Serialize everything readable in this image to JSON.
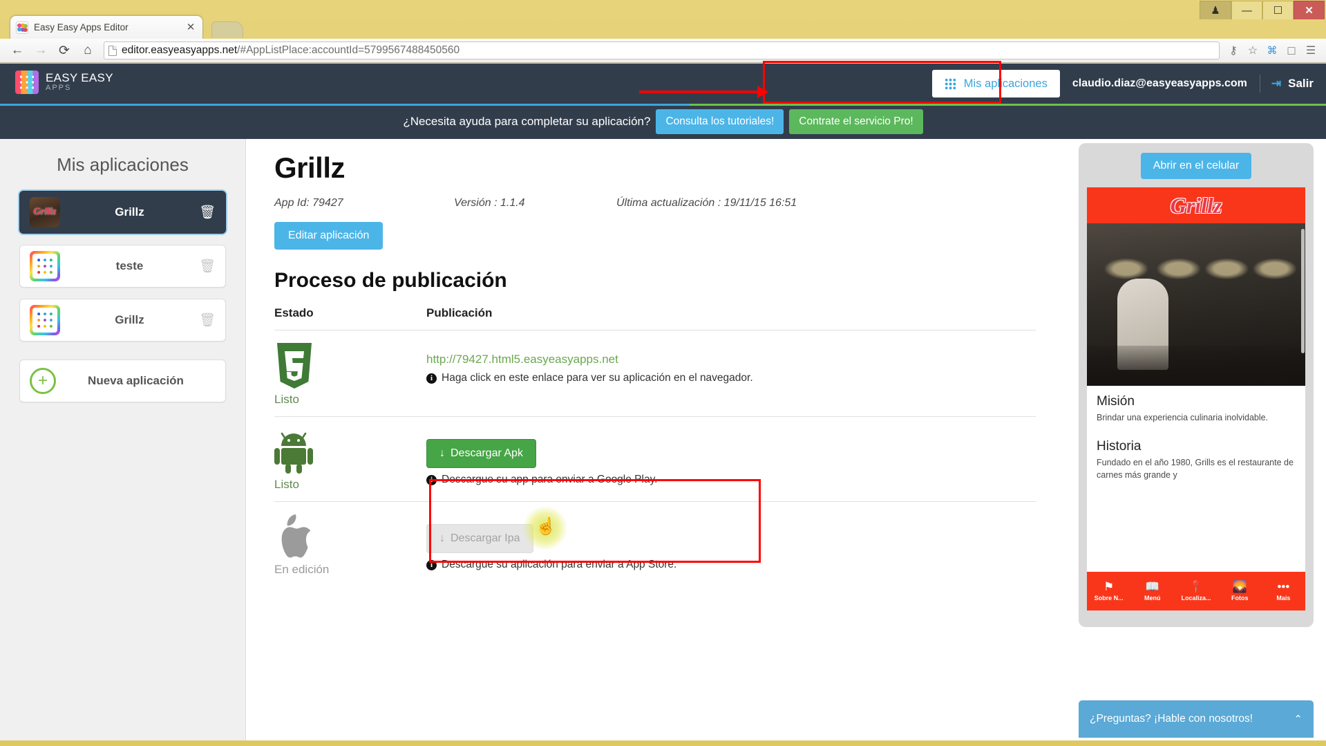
{
  "window": {
    "controls": [
      {
        "name": "user-profile",
        "glyph": "♟"
      },
      {
        "name": "minimize",
        "glyph": "—"
      },
      {
        "name": "maximize",
        "glyph": "☐"
      },
      {
        "name": "close",
        "glyph": "✕"
      }
    ]
  },
  "browser": {
    "tab_title": "Easy Easy Apps Editor",
    "tab_close": "✕",
    "url_host": "editor.easyeasyapps.net",
    "url_path": "/#AppListPlace:accountId=5799567488450560",
    "back": "←",
    "forward": "→",
    "reload": "⟳",
    "home": "⌂",
    "key_icon": "⚷",
    "star_icon": "☆",
    "extension_icon": "⌘",
    "capture_icon": "□",
    "menu_icon": "☰"
  },
  "header": {
    "brand_main": "EASY EASY",
    "brand_sub": "APPS",
    "my_apps_label": "Mis aplicaciones",
    "user_email": "claudio.diaz@easyeasyapps.com",
    "logout_label": "Salir",
    "logout_icon": "⇥"
  },
  "promo": {
    "text": "¿Necesita ayuda para completar su aplicación?",
    "tutorials_label": "Consulta los tutoriales!",
    "pro_label": "Contrate el servicio Pro!"
  },
  "sidebar": {
    "title": "Mis aplicaciones",
    "apps": [
      {
        "name": "Grillz",
        "thumb": "photo",
        "selected": true
      },
      {
        "name": "teste",
        "thumb": "rainbow",
        "selected": false
      },
      {
        "name": "Grillz",
        "thumb": "rainbow",
        "selected": false
      }
    ],
    "trash_glyph": "🗑",
    "new_app_label": "Nueva aplicación",
    "new_app_plus": "+"
  },
  "main": {
    "app_title": "Grillz",
    "app_id": "App Id: 79427",
    "version": "Versión : 1.1.4",
    "last_update": "Última actualización : 19/11/15 16:51",
    "edit_button": "Editar aplicación",
    "section_title": "Proceso de publicación",
    "table": {
      "headers": {
        "state": "Estado",
        "publication": "Publicación"
      },
      "rows": [
        {
          "platform": "html5",
          "state": "Listo",
          "link": "http://79427.html5.easyeasyapps.net",
          "hint": "Haga click en este enlace para ver su aplicación en el navegador.",
          "info_glyph": "i"
        },
        {
          "platform": "android",
          "state": "Listo",
          "button": "Descargar Apk",
          "button_icon": "↓",
          "hint": "Descargue su app para enviar a Google Play.",
          "info_glyph": "i"
        },
        {
          "platform": "apple",
          "state": "En edición",
          "button": "Descargar Ipa",
          "button_icon": "↓",
          "hint": "Descargue su aplicación para enviar a App Store.",
          "info_glyph": "i"
        }
      ]
    }
  },
  "preview": {
    "open_mobile_label": "Abrir en el celular",
    "app_banner": "Grillz",
    "sections": [
      {
        "heading": "Misión",
        "body": "Brindar una experiencia culinaria inolvidable."
      },
      {
        "heading": "Historia",
        "body": "Fundado en el año 1980, Grills es el restaurante de carnes más grande y"
      }
    ],
    "nav": [
      {
        "label": "Sobre N...",
        "glyph": "⚑"
      },
      {
        "label": "Menú",
        "glyph": "📖"
      },
      {
        "label": "Localiza...",
        "glyph": "📍"
      },
      {
        "label": "Fotos",
        "glyph": "🌄"
      },
      {
        "label": "Mais",
        "glyph": "•••"
      }
    ]
  },
  "chat": {
    "label": "¿Preguntas? ¡Hable con nosotros!",
    "chevron": "⌃"
  },
  "colors": {
    "header_bg": "#323d4c",
    "accent_blue": "#4cb5e8",
    "accent_green": "#5cb85c",
    "annotation_red": "#ff0000",
    "banner_red": "#f9361a"
  }
}
